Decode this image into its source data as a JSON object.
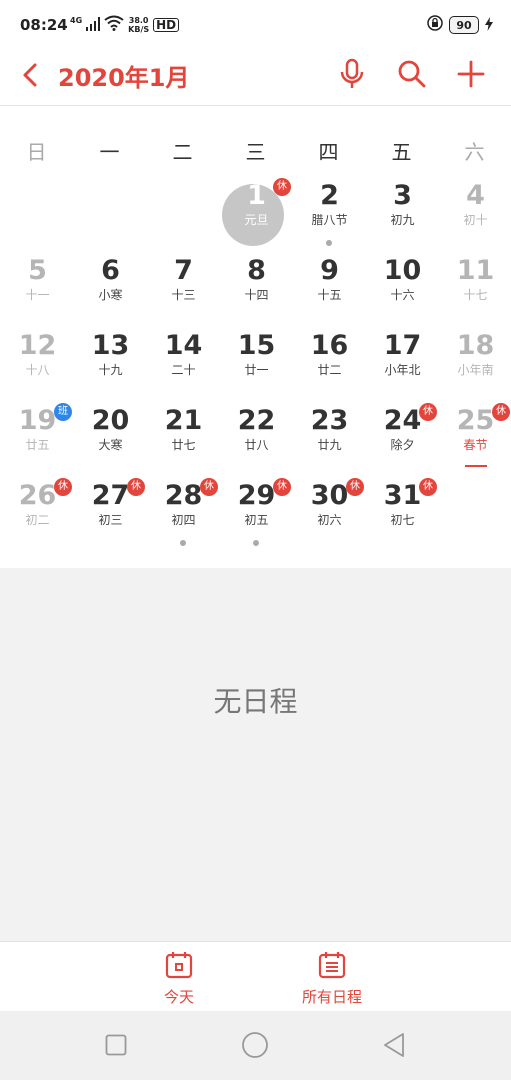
{
  "status": {
    "time": "08:24",
    "network": "4G",
    "speed_top": "38.0",
    "speed_bottom": "KB/S",
    "hd": "HD",
    "battery": "90"
  },
  "header": {
    "title": "2020年1月"
  },
  "weekdays": [
    "日",
    "一",
    "二",
    "三",
    "四",
    "五",
    "六"
  ],
  "days": [
    {
      "num": "1",
      "lunar": "元旦",
      "badge": "休",
      "selected": true
    },
    {
      "num": "2",
      "lunar": "腊八节",
      "dot": true
    },
    {
      "num": "3",
      "lunar": "初九"
    },
    {
      "num": "4",
      "lunar": "初十"
    },
    {
      "num": "5",
      "lunar": "十一"
    },
    {
      "num": "6",
      "lunar": "小寒"
    },
    {
      "num": "7",
      "lunar": "十三"
    },
    {
      "num": "8",
      "lunar": "十四"
    },
    {
      "num": "9",
      "lunar": "十五"
    },
    {
      "num": "10",
      "lunar": "十六"
    },
    {
      "num": "11",
      "lunar": "十七"
    },
    {
      "num": "12",
      "lunar": "十八"
    },
    {
      "num": "13",
      "lunar": "十九"
    },
    {
      "num": "14",
      "lunar": "二十"
    },
    {
      "num": "15",
      "lunar": "廿一"
    },
    {
      "num": "16",
      "lunar": "廿二"
    },
    {
      "num": "17",
      "lunar": "小年北"
    },
    {
      "num": "18",
      "lunar": "小年南"
    },
    {
      "num": "19",
      "lunar": "廿五",
      "badge": "班",
      "work": true
    },
    {
      "num": "20",
      "lunar": "大寒"
    },
    {
      "num": "21",
      "lunar": "廿七"
    },
    {
      "num": "22",
      "lunar": "廿八"
    },
    {
      "num": "23",
      "lunar": "廿九"
    },
    {
      "num": "24",
      "lunar": "除夕",
      "badge": "休"
    },
    {
      "num": "25",
      "lunar": "春节",
      "badge": "休",
      "holiday_text": true
    },
    {
      "num": "26",
      "lunar": "初二",
      "badge": "休"
    },
    {
      "num": "27",
      "lunar": "初三",
      "badge": "休"
    },
    {
      "num": "28",
      "lunar": "初四",
      "badge": "休",
      "dot": true
    },
    {
      "num": "29",
      "lunar": "初五",
      "badge": "休",
      "dot": true
    },
    {
      "num": "30",
      "lunar": "初六",
      "badge": "休"
    },
    {
      "num": "31",
      "lunar": "初七",
      "badge": "休"
    }
  ],
  "first_weekday": 3,
  "schedule": {
    "empty_text": "无日程"
  },
  "bottom_nav": {
    "today": "今天",
    "all": "所有日程"
  },
  "colors": {
    "accent": "#e2453b",
    "work_badge": "#2f86e6",
    "selected_circle": "#c6c6c6"
  }
}
